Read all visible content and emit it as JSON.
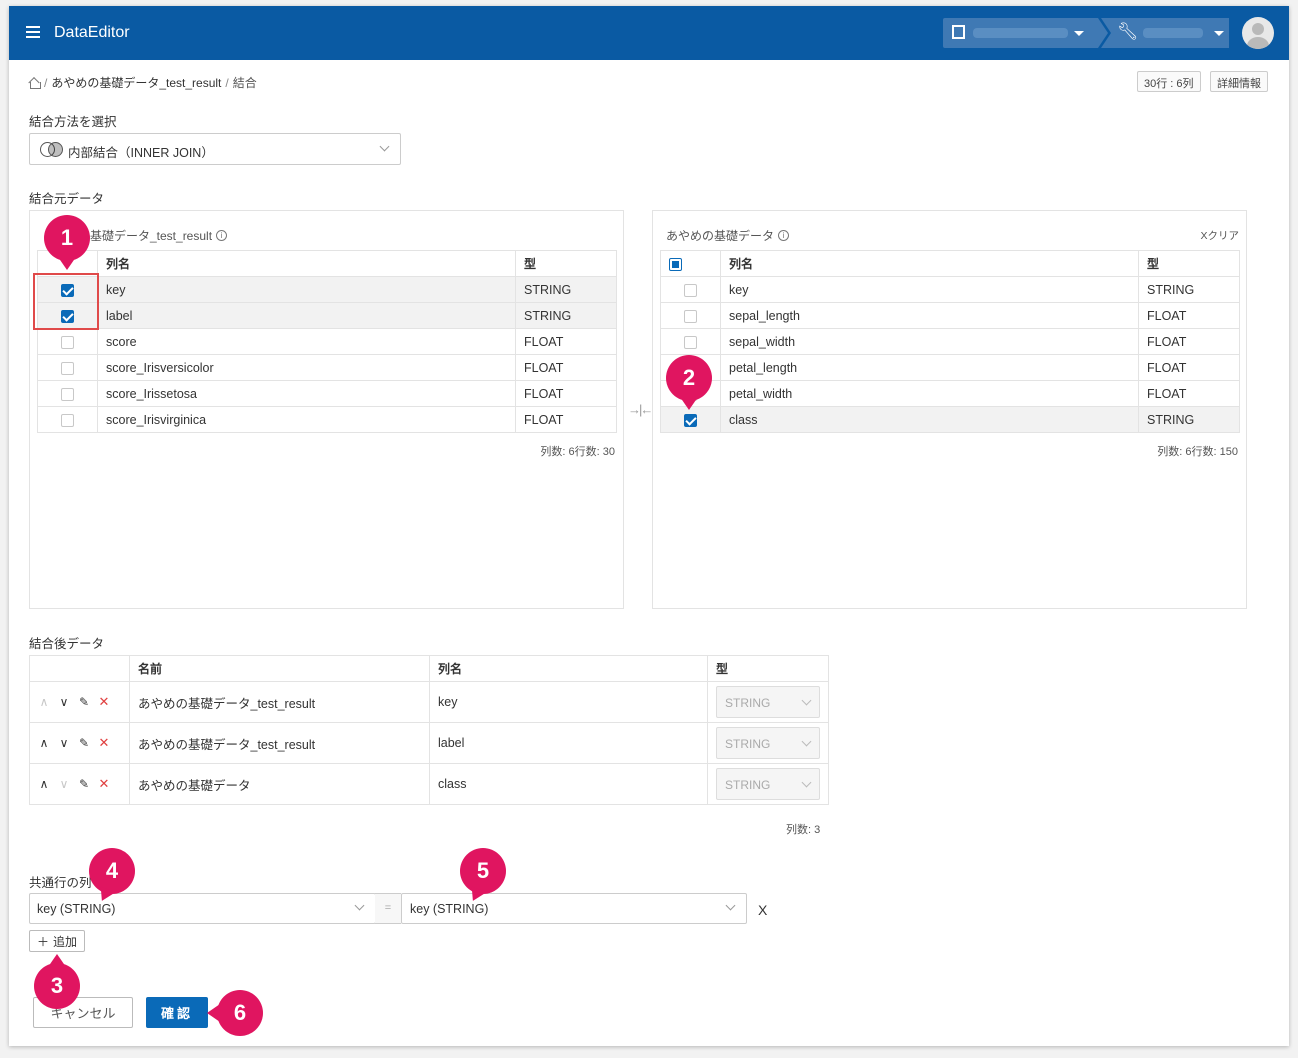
{
  "header": {
    "app_title": "DataEditor"
  },
  "breadcrumb": {
    "dataset": "あやめの基礎データ_test_result",
    "current": "結合"
  },
  "chips": {
    "size": "30行 : 6列",
    "details": "詳細情報"
  },
  "join_method": {
    "label": "結合方法を選択",
    "value": "内部結合（INNER JOIN）"
  },
  "source_section": {
    "label": "結合元データ"
  },
  "left_table": {
    "title": "基礎データ_test_result",
    "col_header": "列名",
    "type_header": "型",
    "rows": [
      {
        "name": "key",
        "type": "STRING",
        "checked": true
      },
      {
        "name": "label",
        "type": "STRING",
        "checked": true
      },
      {
        "name": "score",
        "type": "FLOAT",
        "checked": false
      },
      {
        "name": "score_Irisversicolor",
        "type": "FLOAT",
        "checked": false
      },
      {
        "name": "score_Irissetosa",
        "type": "FLOAT",
        "checked": false
      },
      {
        "name": "score_Irisvirginica",
        "type": "FLOAT",
        "checked": false
      }
    ],
    "count": "列数: 6行数: 30"
  },
  "right_table": {
    "title": "あやめの基礎データ",
    "clear": "Xクリア",
    "col_header": "列名",
    "type_header": "型",
    "rows": [
      {
        "name": "key",
        "type": "STRING",
        "checked": false
      },
      {
        "name": "sepal_length",
        "type": "FLOAT",
        "checked": false
      },
      {
        "name": "sepal_width",
        "type": "FLOAT",
        "checked": false
      },
      {
        "name": "petal_length",
        "type": "FLOAT",
        "checked": false
      },
      {
        "name": "petal_width",
        "type": "FLOAT",
        "checked": false
      },
      {
        "name": "class",
        "type": "STRING",
        "checked": true
      }
    ],
    "count": "列数: 6行数: 150"
  },
  "result_section": {
    "label": "結合後データ",
    "headers": {
      "name": "名前",
      "column": "列名",
      "type": "型"
    },
    "rows": [
      {
        "name": "あやめの基礎データ_test_result",
        "column": "key",
        "type": "STRING"
      },
      {
        "name": "あやめの基礎データ_test_result",
        "column": "label",
        "type": "STRING"
      },
      {
        "name": "あやめの基礎データ",
        "column": "class",
        "type": "STRING"
      }
    ],
    "count": "列数: 3"
  },
  "common_row": {
    "label": "共通行の列",
    "left_value": "key (STRING)",
    "equals": "=",
    "right_value": "key (STRING)",
    "remove": "X"
  },
  "buttons": {
    "add": "追加",
    "cancel": "キャンセル",
    "confirm": "確認"
  },
  "markers": [
    "1",
    "2",
    "3",
    "4",
    "5",
    "6"
  ],
  "colors": {
    "header": "#0a5aa3",
    "primary": "#0a6ab8",
    "marker": "#e01560",
    "highlight": "#e04a4a"
  }
}
